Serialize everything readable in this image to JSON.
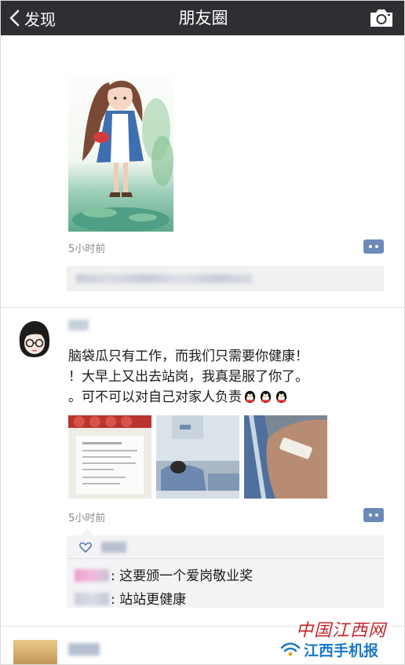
{
  "nav": {
    "back_label": "发现",
    "title": "朋友圈"
  },
  "posts": [
    {
      "time": "5小时前"
    },
    {
      "text_lines": [
        "脑袋瓜只有工作，而我们只需要你健康！",
        "！大早上又出去站岗，我真是服了你了。",
        "。可不可以对自己对家人负责"
      ],
      "emoji_count": 3,
      "images": [
        "document-photo",
        "hospital-bed-photo",
        "bandaged-arm-photo"
      ],
      "time": "5小时前",
      "comments": [
        {
          "name_suffix": "吗",
          "text": ": 这要颁一个爱岗敬业奖"
        },
        {
          "name_suffix": "心",
          "text": ": 站站更健康"
        }
      ]
    }
  ],
  "watermark": {
    "line1": "中国江西网",
    "line2": "江西手机报"
  },
  "colors": {
    "navbar": "#2e2f33",
    "comment_button": "#6b8ab8",
    "watermark_red": "#c5262b",
    "watermark_blue": "#1b78c8"
  }
}
